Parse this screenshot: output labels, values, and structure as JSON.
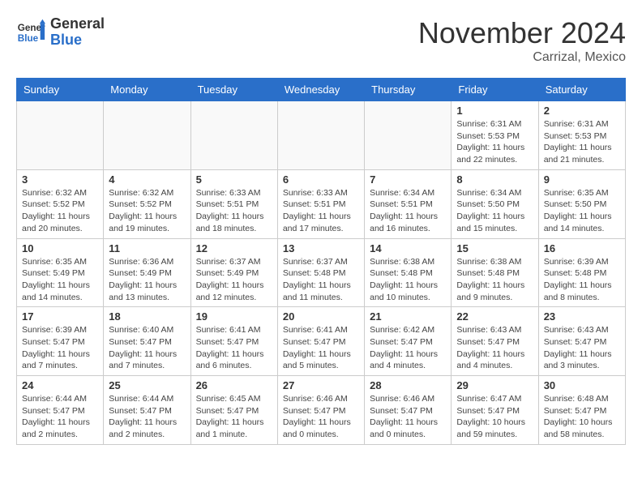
{
  "header": {
    "logo_general": "General",
    "logo_blue": "Blue",
    "month_title": "November 2024",
    "location": "Carrizal, Mexico"
  },
  "days_of_week": [
    "Sunday",
    "Monday",
    "Tuesday",
    "Wednesday",
    "Thursday",
    "Friday",
    "Saturday"
  ],
  "weeks": [
    [
      {
        "day": "",
        "info": ""
      },
      {
        "day": "",
        "info": ""
      },
      {
        "day": "",
        "info": ""
      },
      {
        "day": "",
        "info": ""
      },
      {
        "day": "",
        "info": ""
      },
      {
        "day": "1",
        "info": "Sunrise: 6:31 AM\nSunset: 5:53 PM\nDaylight: 11 hours and 22 minutes."
      },
      {
        "day": "2",
        "info": "Sunrise: 6:31 AM\nSunset: 5:53 PM\nDaylight: 11 hours and 21 minutes."
      }
    ],
    [
      {
        "day": "3",
        "info": "Sunrise: 6:32 AM\nSunset: 5:52 PM\nDaylight: 11 hours and 20 minutes."
      },
      {
        "day": "4",
        "info": "Sunrise: 6:32 AM\nSunset: 5:52 PM\nDaylight: 11 hours and 19 minutes."
      },
      {
        "day": "5",
        "info": "Sunrise: 6:33 AM\nSunset: 5:51 PM\nDaylight: 11 hours and 18 minutes."
      },
      {
        "day": "6",
        "info": "Sunrise: 6:33 AM\nSunset: 5:51 PM\nDaylight: 11 hours and 17 minutes."
      },
      {
        "day": "7",
        "info": "Sunrise: 6:34 AM\nSunset: 5:51 PM\nDaylight: 11 hours and 16 minutes."
      },
      {
        "day": "8",
        "info": "Sunrise: 6:34 AM\nSunset: 5:50 PM\nDaylight: 11 hours and 15 minutes."
      },
      {
        "day": "9",
        "info": "Sunrise: 6:35 AM\nSunset: 5:50 PM\nDaylight: 11 hours and 14 minutes."
      }
    ],
    [
      {
        "day": "10",
        "info": "Sunrise: 6:35 AM\nSunset: 5:49 PM\nDaylight: 11 hours and 14 minutes."
      },
      {
        "day": "11",
        "info": "Sunrise: 6:36 AM\nSunset: 5:49 PM\nDaylight: 11 hours and 13 minutes."
      },
      {
        "day": "12",
        "info": "Sunrise: 6:37 AM\nSunset: 5:49 PM\nDaylight: 11 hours and 12 minutes."
      },
      {
        "day": "13",
        "info": "Sunrise: 6:37 AM\nSunset: 5:48 PM\nDaylight: 11 hours and 11 minutes."
      },
      {
        "day": "14",
        "info": "Sunrise: 6:38 AM\nSunset: 5:48 PM\nDaylight: 11 hours and 10 minutes."
      },
      {
        "day": "15",
        "info": "Sunrise: 6:38 AM\nSunset: 5:48 PM\nDaylight: 11 hours and 9 minutes."
      },
      {
        "day": "16",
        "info": "Sunrise: 6:39 AM\nSunset: 5:48 PM\nDaylight: 11 hours and 8 minutes."
      }
    ],
    [
      {
        "day": "17",
        "info": "Sunrise: 6:39 AM\nSunset: 5:47 PM\nDaylight: 11 hours and 7 minutes."
      },
      {
        "day": "18",
        "info": "Sunrise: 6:40 AM\nSunset: 5:47 PM\nDaylight: 11 hours and 7 minutes."
      },
      {
        "day": "19",
        "info": "Sunrise: 6:41 AM\nSunset: 5:47 PM\nDaylight: 11 hours and 6 minutes."
      },
      {
        "day": "20",
        "info": "Sunrise: 6:41 AM\nSunset: 5:47 PM\nDaylight: 11 hours and 5 minutes."
      },
      {
        "day": "21",
        "info": "Sunrise: 6:42 AM\nSunset: 5:47 PM\nDaylight: 11 hours and 4 minutes."
      },
      {
        "day": "22",
        "info": "Sunrise: 6:43 AM\nSunset: 5:47 PM\nDaylight: 11 hours and 4 minutes."
      },
      {
        "day": "23",
        "info": "Sunrise: 6:43 AM\nSunset: 5:47 PM\nDaylight: 11 hours and 3 minutes."
      }
    ],
    [
      {
        "day": "24",
        "info": "Sunrise: 6:44 AM\nSunset: 5:47 PM\nDaylight: 11 hours and 2 minutes."
      },
      {
        "day": "25",
        "info": "Sunrise: 6:44 AM\nSunset: 5:47 PM\nDaylight: 11 hours and 2 minutes."
      },
      {
        "day": "26",
        "info": "Sunrise: 6:45 AM\nSunset: 5:47 PM\nDaylight: 11 hours and 1 minute."
      },
      {
        "day": "27",
        "info": "Sunrise: 6:46 AM\nSunset: 5:47 PM\nDaylight: 11 hours and 0 minutes."
      },
      {
        "day": "28",
        "info": "Sunrise: 6:46 AM\nSunset: 5:47 PM\nDaylight: 11 hours and 0 minutes."
      },
      {
        "day": "29",
        "info": "Sunrise: 6:47 AM\nSunset: 5:47 PM\nDaylight: 10 hours and 59 minutes."
      },
      {
        "day": "30",
        "info": "Sunrise: 6:48 AM\nSunset: 5:47 PM\nDaylight: 10 hours and 58 minutes."
      }
    ]
  ]
}
